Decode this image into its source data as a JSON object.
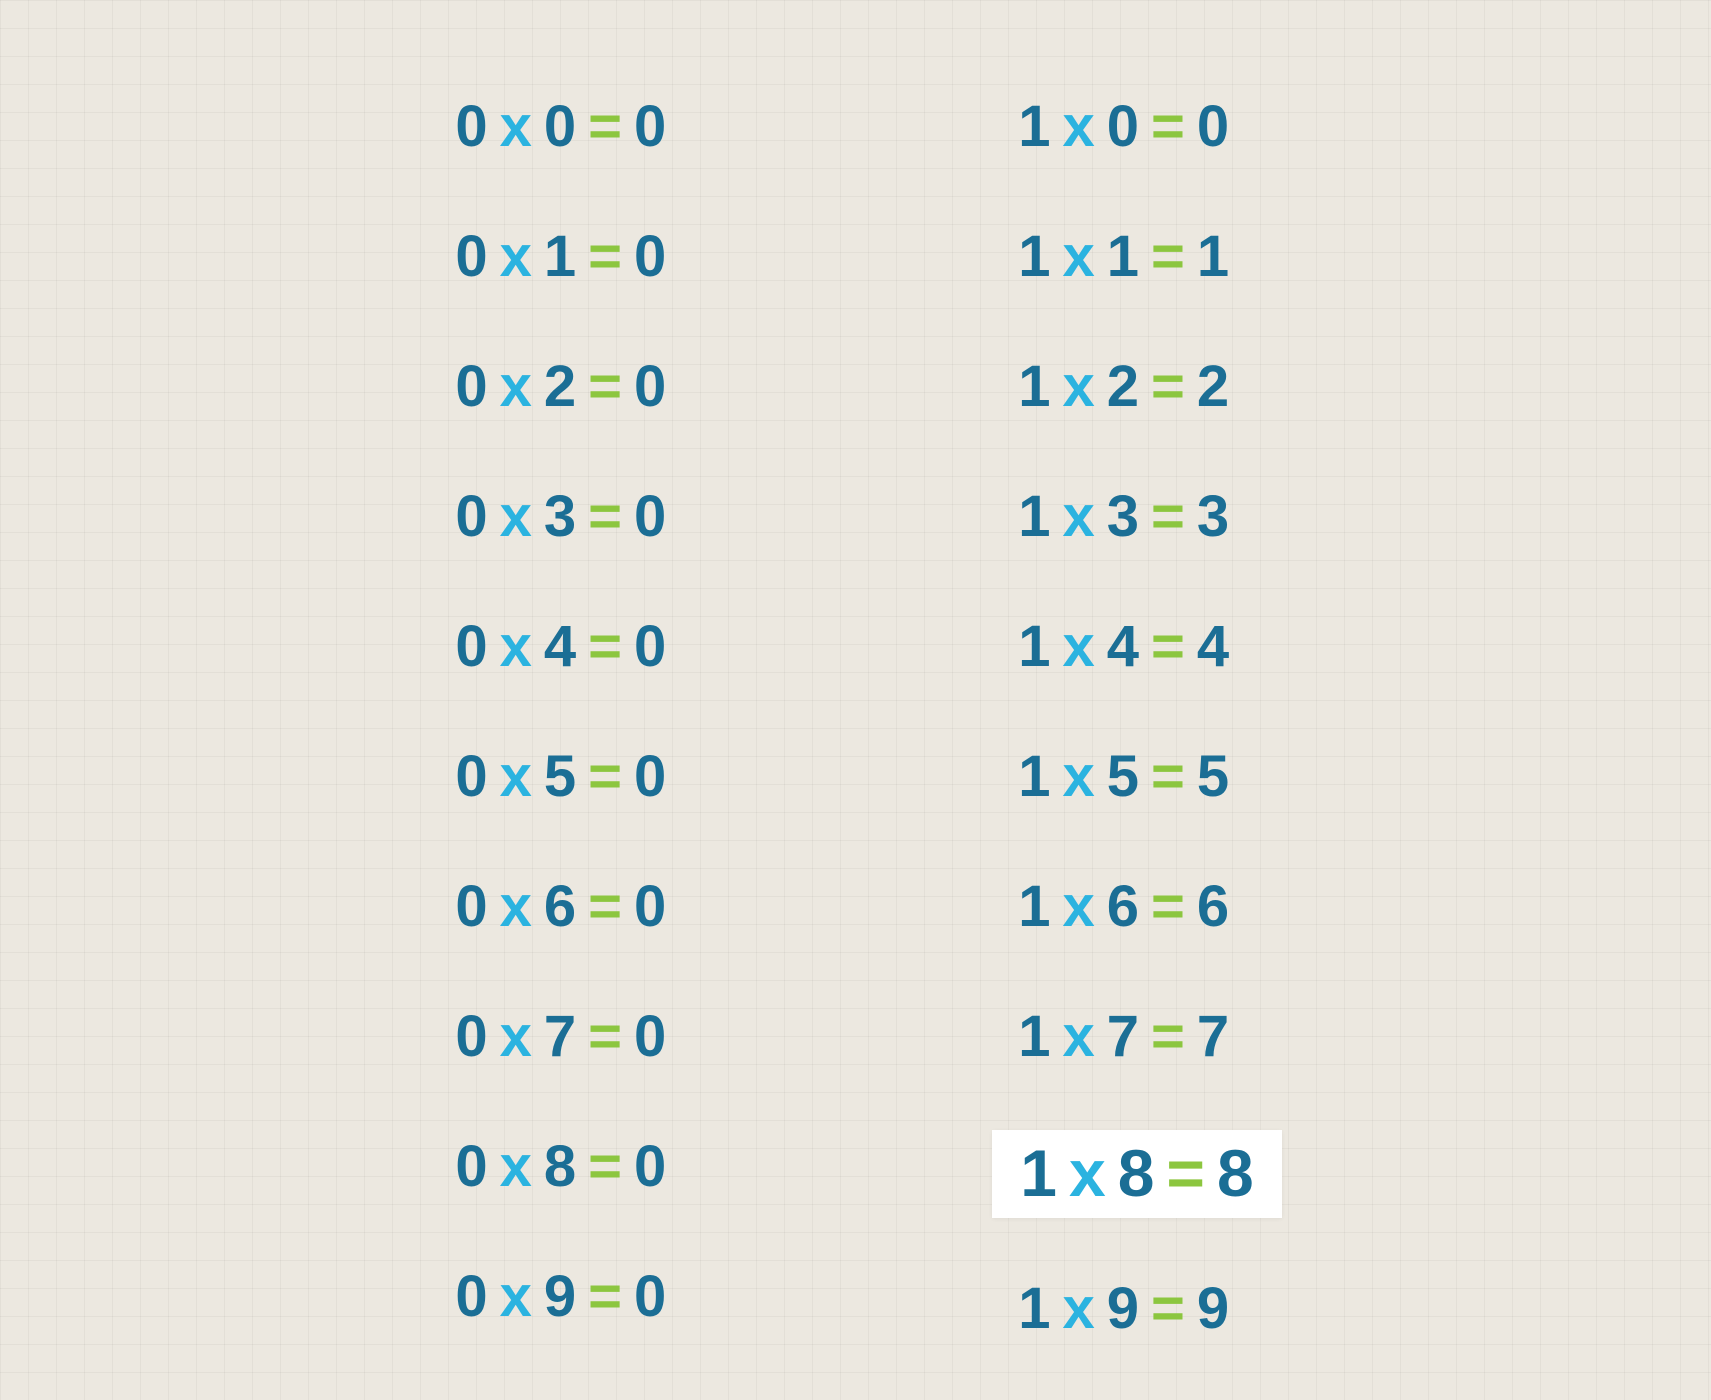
{
  "colors": {
    "numbers": "#1b6e95",
    "multiply": "#2bb3e0",
    "equals": "#8cc63f",
    "highlight_bg": "#ffffff",
    "page_bg": "#ece8e0"
  },
  "symbols": {
    "times": "x",
    "equals": "="
  },
  "columns": [
    {
      "rows": [
        {
          "a": "0",
          "b": "0",
          "r": "0",
          "highlight": false
        },
        {
          "a": "0",
          "b": "1",
          "r": "0",
          "highlight": false
        },
        {
          "a": "0",
          "b": "2",
          "r": "0",
          "highlight": false
        },
        {
          "a": "0",
          "b": "3",
          "r": "0",
          "highlight": false
        },
        {
          "a": "0",
          "b": "4",
          "r": "0",
          "highlight": false
        },
        {
          "a": "0",
          "b": "5",
          "r": "0",
          "highlight": false
        },
        {
          "a": "0",
          "b": "6",
          "r": "0",
          "highlight": false
        },
        {
          "a": "0",
          "b": "7",
          "r": "0",
          "highlight": false
        },
        {
          "a": "0",
          "b": "8",
          "r": "0",
          "highlight": false
        },
        {
          "a": "0",
          "b": "9",
          "r": "0",
          "highlight": false
        }
      ]
    },
    {
      "rows": [
        {
          "a": "1",
          "b": "0",
          "r": "0",
          "highlight": false
        },
        {
          "a": "1",
          "b": "1",
          "r": "1",
          "highlight": false
        },
        {
          "a": "1",
          "b": "2",
          "r": "2",
          "highlight": false
        },
        {
          "a": "1",
          "b": "3",
          "r": "3",
          "highlight": false
        },
        {
          "a": "1",
          "b": "4",
          "r": "4",
          "highlight": false
        },
        {
          "a": "1",
          "b": "5",
          "r": "5",
          "highlight": false
        },
        {
          "a": "1",
          "b": "6",
          "r": "6",
          "highlight": false
        },
        {
          "a": "1",
          "b": "7",
          "r": "7",
          "highlight": false
        },
        {
          "a": "1",
          "b": "8",
          "r": "8",
          "highlight": true
        },
        {
          "a": "1",
          "b": "9",
          "r": "9",
          "highlight": false
        }
      ]
    }
  ]
}
